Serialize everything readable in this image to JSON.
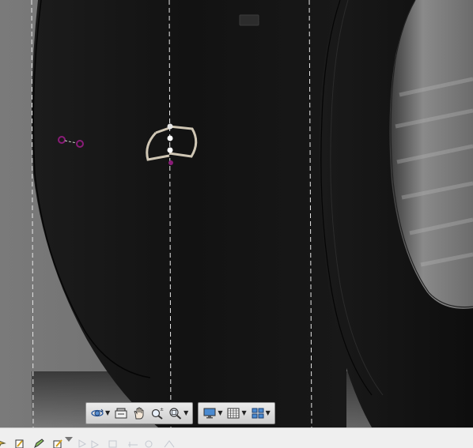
{
  "app": {
    "mode": "cad-3d-viewport"
  },
  "colors": {
    "background": "#6f6f6f",
    "part_dark": "#151515",
    "constraint_magenta": "#8a1c78",
    "sketch_line": "#d9d9d9",
    "toolbar_bg": "#dadada"
  },
  "nav_toolbar": {
    "groups": [
      {
        "name": "navigation",
        "items": [
          {
            "id": "orbit",
            "icon": "orbit-icon",
            "dropdown": true
          },
          {
            "id": "look-at",
            "icon": "look-at-icon",
            "dropdown": false
          },
          {
            "id": "pan",
            "icon": "pan-hand-icon",
            "dropdown": false
          },
          {
            "id": "zoom",
            "icon": "zoom-icon",
            "dropdown": false
          },
          {
            "id": "zoom-window",
            "icon": "zoom-window-icon",
            "dropdown": true
          }
        ]
      },
      {
        "name": "display",
        "items": [
          {
            "id": "display-settings",
            "icon": "monitor-icon",
            "dropdown": true
          },
          {
            "id": "grid",
            "icon": "grid-icon",
            "dropdown": true
          },
          {
            "id": "viewports",
            "icon": "viewports-icon",
            "dropdown": true
          }
        ]
      }
    ]
  },
  "status_bar": {
    "icons": [
      "select-icon",
      "sketch-icon",
      "edit-icon",
      "selection-filter-icon",
      "next-icon",
      "faded-tool-icons"
    ]
  }
}
